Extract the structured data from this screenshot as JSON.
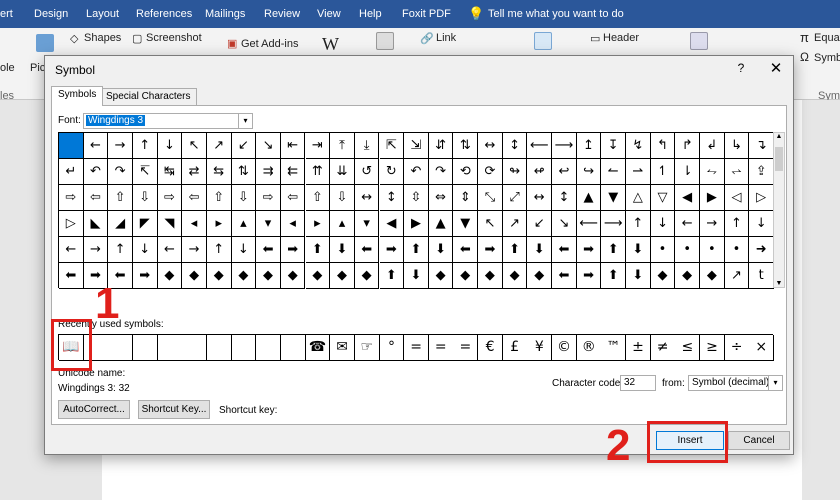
{
  "ribbon": {
    "tabs": [
      "ert",
      "Design",
      "Layout",
      "References",
      "Mailings",
      "Review",
      "View",
      "Help",
      "Foxit PDF",
      "Tell me what you want to do"
    ],
    "items": [
      "Shapes",
      "Screenshot",
      "Get Add-ins",
      "Link",
      "Header",
      "Equat",
      "Symb",
      "Pic",
      "ole",
      "les",
      "Symb"
    ]
  },
  "dialog": {
    "title": "Symbol",
    "help": "?",
    "close": "✕",
    "tabs": [
      "Symbols",
      "Special Characters"
    ],
    "font_label": "Font:",
    "font_value": "Wingdings 3",
    "symbol_rows": [
      [
        "",
        "←",
        "→",
        "↑",
        "↓",
        "↖",
        "↗",
        "↙",
        "↘",
        "⇤",
        "⇥",
        "⤒",
        "⤓",
        "⇱",
        "⇲",
        "⇵",
        "⇅",
        "↔",
        "↕",
        "⟵",
        "⟶",
        "↥",
        "↧",
        "↯",
        "↰",
        "↱",
        "↲",
        "↳",
        "↴"
      ],
      [
        "↵",
        "↶",
        "↷",
        "↸",
        "↹",
        "⇄",
        "⇆",
        "⇅",
        "⇉",
        "⇇",
        "⇈",
        "⇊",
        "↺",
        "↻",
        "↶",
        "↷",
        "⟲",
        "⟳",
        "↬",
        "↫",
        "↩",
        "↪",
        "↼",
        "⇀",
        "↿",
        "⇂",
        "⥊",
        "⥋",
        "⇪"
      ],
      [
        "⇨",
        "⇦",
        "⇧",
        "⇩",
        "⇨",
        "⇦",
        "⇧",
        "⇩",
        "⇨",
        "⇦",
        "⇧",
        "⇩",
        "↔",
        "↕",
        "⇳",
        "⇔",
        "⇕",
        "⤡",
        "⤢",
        "↔",
        "↕",
        "▲",
        "▼",
        "△",
        "▽",
        "◀",
        "▶",
        "◁",
        "▷"
      ],
      [
        "▷",
        "◣",
        "◢",
        "◤",
        "◥",
        "◂",
        "▸",
        "▴",
        "▾",
        "◂",
        "▸",
        "▴",
        "▾",
        "◀",
        "▶",
        "▲",
        "▼",
        "↖",
        "↗",
        "↙",
        "↘",
        "⟵",
        "⟶",
        "↑",
        "↓",
        "←",
        "→",
        "↑",
        "↓"
      ],
      [
        "←",
        "→",
        "↑",
        "↓",
        "←",
        "→",
        "↑",
        "↓",
        "⬅",
        "➡",
        "⬆",
        "⬇",
        "⬅",
        "➡",
        "⬆",
        "⬇",
        "⬅",
        "➡",
        "⬆",
        "⬇",
        "⬅",
        "➡",
        "⬆",
        "⬇",
        "•",
        "•",
        "•",
        "•",
        "➜"
      ],
      [
        "⬅",
        "➡",
        "⬅",
        "➡",
        "◆",
        "◆",
        "◆",
        "◆",
        "◆",
        "◆",
        "◆",
        "◆",
        "◆",
        "⬆",
        "⬇",
        "◆",
        "◆",
        "◆",
        "◆",
        "◆",
        "⬅",
        "➡",
        "⬆",
        "⬇",
        "◆",
        "◆",
        "◆",
        "↗",
        "t"
      ]
    ],
    "recent_label": "Recently used symbols:",
    "recent": [
      "📖",
      "",
      "",
      "",
      "",
      "",
      "",
      "",
      "",
      "",
      "☎",
      "✉",
      "☞",
      "°",
      "=",
      "=",
      "=",
      "€",
      "£",
      "¥",
      "©",
      "®",
      "™",
      "±",
      "≠",
      "≤",
      "≥",
      "÷",
      "×"
    ],
    "unicode_label": "Unicode name:",
    "unicode_value": "Wingdings 3: 32",
    "char_code_label": "Character code:",
    "char_code_value": "32",
    "from_label": "from:",
    "from_value": "Symbol (decimal)",
    "autocorrect": "AutoCorrect...",
    "shortcut_key_btn": "Shortcut Key...",
    "shortcut_key_label": "Shortcut key:",
    "insert": "Insert",
    "cancel": "Cancel"
  },
  "annotations": [
    "1",
    "2"
  ],
  "colors": {
    "accent": "#0078d7",
    "highlight": "#e0201b",
    "ribbon": "#2b579a"
  }
}
